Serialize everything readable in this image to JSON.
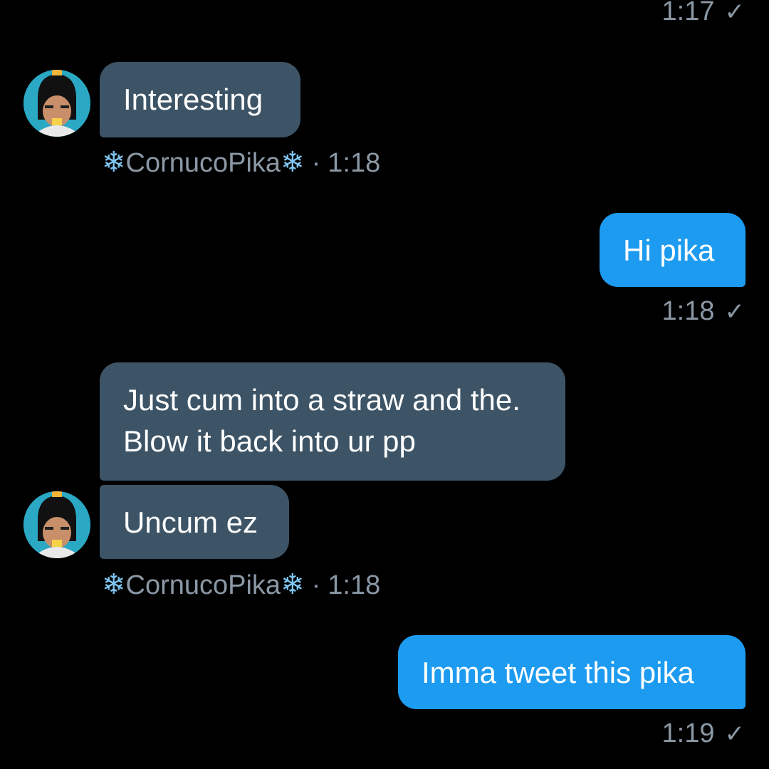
{
  "conversation": {
    "top_timestamp": "1:17",
    "messages": [
      {
        "id": "m1",
        "direction": "incoming",
        "text": "Interesting"
      },
      {
        "id": "m2",
        "direction": "outgoing",
        "text": "Hi pika",
        "time": "1:18"
      },
      {
        "id": "m3",
        "direction": "incoming",
        "text": "Just cum into a straw and the. Blow it back into ur pp"
      },
      {
        "id": "m4",
        "direction": "incoming",
        "text": "Uncum ez"
      },
      {
        "id": "m5",
        "direction": "outgoing",
        "text": "Imma tweet this pika",
        "time": "1:19"
      }
    ],
    "incoming_groups": [
      {
        "sender": "CornucoPika",
        "time": "1:18"
      },
      {
        "sender": "CornucoPika",
        "time": "1:18"
      }
    ]
  },
  "icons": {
    "sent_check": "check-icon",
    "snowflake": "snowflake-icon",
    "avatar": "avatar-icon"
  },
  "glyphs": {
    "check": "✓",
    "snowflake": "❄",
    "separator": "·"
  },
  "colors": {
    "background": "#000000",
    "incoming_bubble": "#3d5466",
    "outgoing_bubble": "#1d9bf0",
    "meta_text": "#8b98a5",
    "snowflake": "#7fc6f2"
  }
}
